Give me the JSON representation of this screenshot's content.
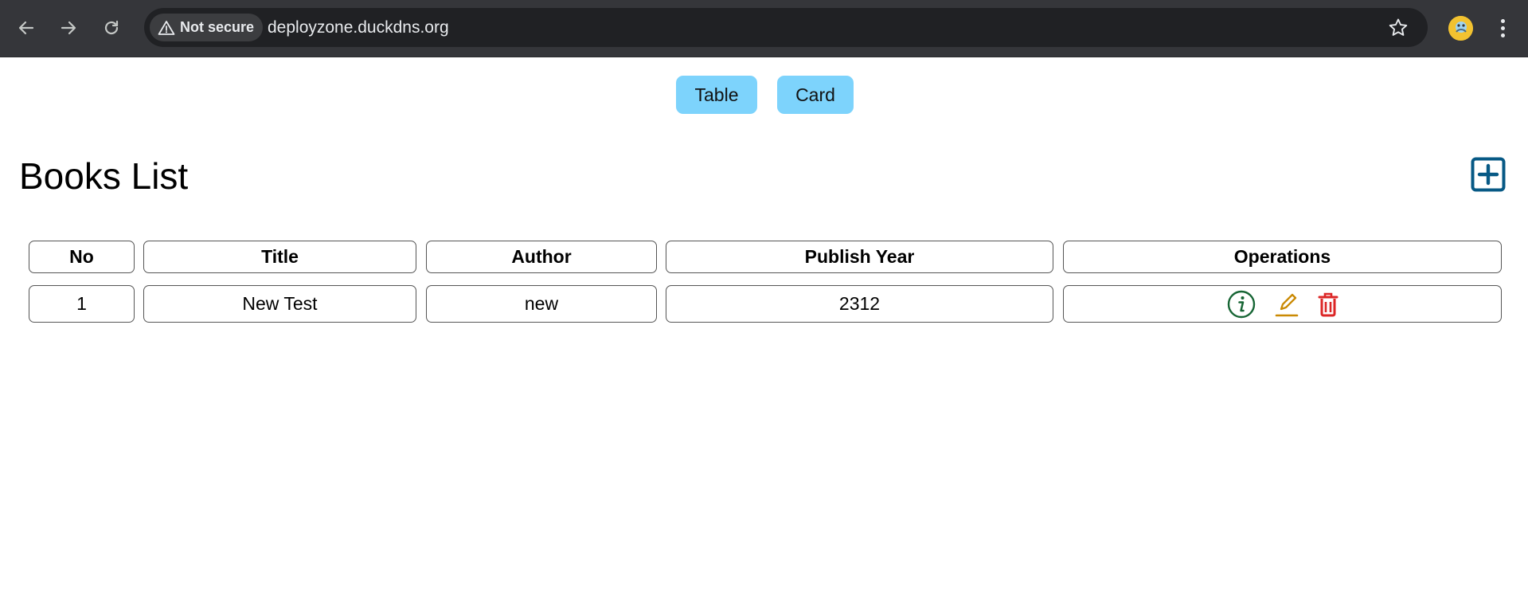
{
  "browser": {
    "security_label": "Not secure",
    "url": "deployzone.duckdns.org"
  },
  "view_toggle": {
    "table_label": "Table",
    "card_label": "Card"
  },
  "page": {
    "title": "Books List"
  },
  "table": {
    "headers": [
      "No",
      "Title",
      "Author",
      "Publish Year",
      "Operations"
    ],
    "rows": [
      {
        "no": "1",
        "title": "New Test",
        "author": "new",
        "publish_year": "2312"
      }
    ]
  },
  "colors": {
    "accent_button": "#7dd3fc",
    "add_icon": "#075985",
    "info_icon": "#166534",
    "edit_icon": "#ca8a04",
    "delete_icon": "#dc2626"
  },
  "icons": {
    "add": "square-plus-icon",
    "info": "info-circle-icon",
    "edit": "pencil-icon",
    "delete": "trash-icon"
  }
}
